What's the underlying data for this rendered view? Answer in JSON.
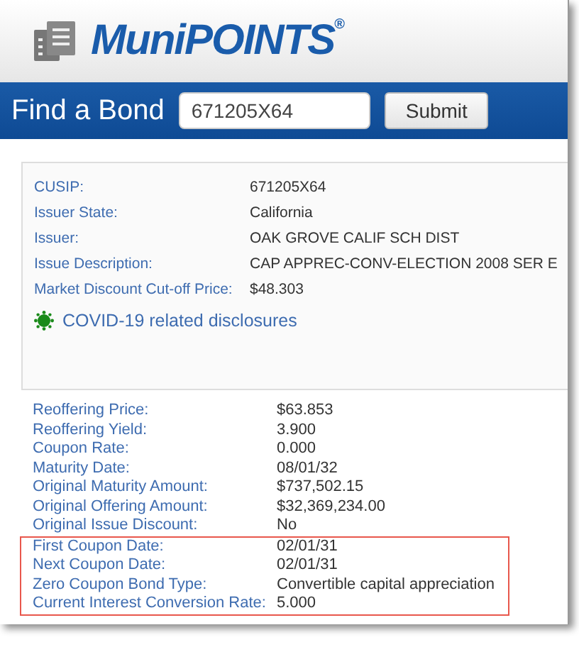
{
  "logo": {
    "name": "MuniPOINTS",
    "mark": "®"
  },
  "search_bar": {
    "label": "Find a Bond",
    "value": "671205X64",
    "button": "Submit"
  },
  "summary": [
    {
      "label": "CUSIP:",
      "value": "671205X64"
    },
    {
      "label": "Issuer State:",
      "value": "California"
    },
    {
      "label": "Issuer:",
      "value": "OAK GROVE CALIF SCH DIST"
    },
    {
      "label": "Issue Description:",
      "value": "CAP APPREC-CONV-ELECTION 2008 SER E"
    },
    {
      "label": "Market Discount Cut-off Price:",
      "value": "$48.303"
    }
  ],
  "covid_link": "COVID-19 related disclosures",
  "details": [
    {
      "label": "Reoffering Price:",
      "value": "$63.853"
    },
    {
      "label": "Reoffering Yield:",
      "value": "3.900"
    },
    {
      "label": "Coupon Rate:",
      "value": "0.000"
    },
    {
      "label": "Maturity Date:",
      "value": "08/01/32"
    },
    {
      "label": "Original Maturity Amount:",
      "value": "$737,502.15"
    },
    {
      "label": "Original Offering Amount:",
      "value": "$32,369,234.00"
    },
    {
      "label": "Original Issue Discount:",
      "value": "No"
    }
  ],
  "highlighted_details": [
    {
      "label": "First Coupon Date:",
      "value": "02/01/31"
    },
    {
      "label": "Next Coupon Date:",
      "value": "02/01/31"
    },
    {
      "label": "Zero Coupon Bond Type:",
      "value": "Convertible capital appreciation"
    },
    {
      "label": "Current Interest Conversion Rate:",
      "value": "5.000"
    }
  ]
}
